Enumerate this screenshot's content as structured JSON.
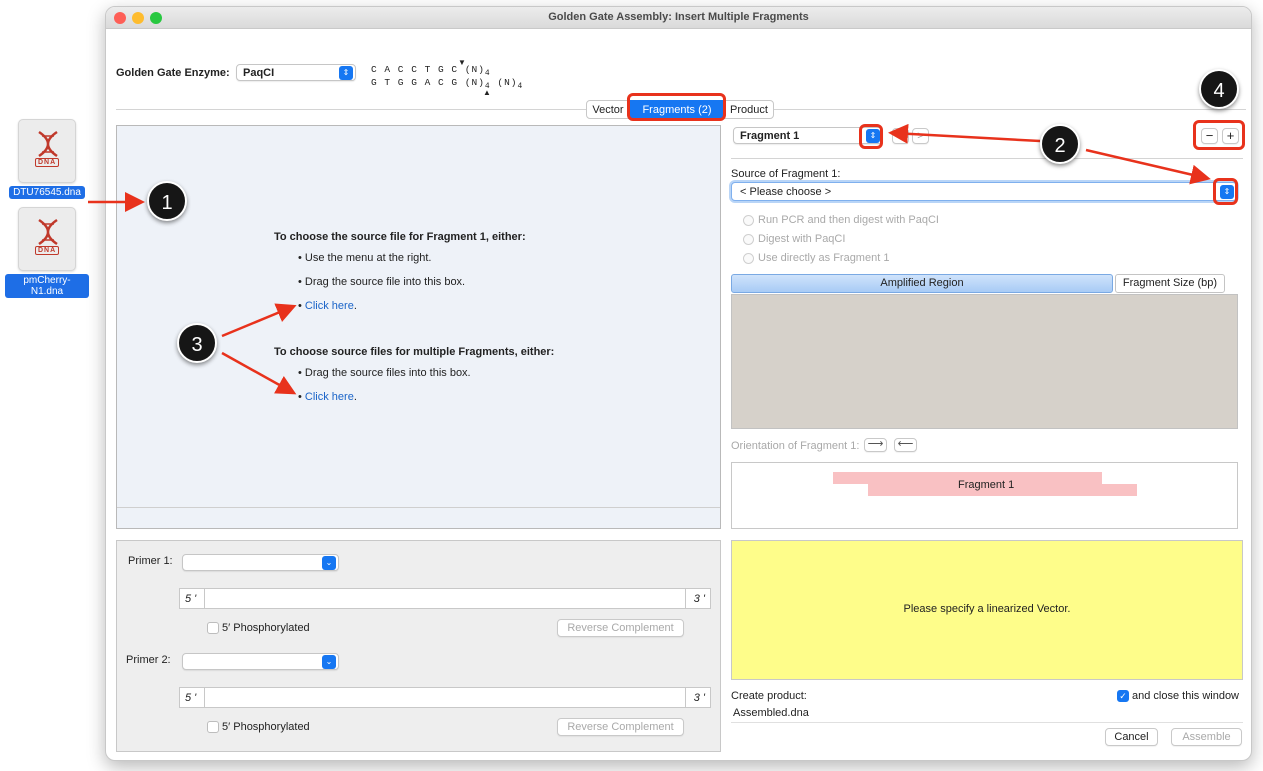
{
  "desktop": {
    "file1": "DTU76545.dna",
    "file2": "pmCherry-N1.dna",
    "dna_badge": "DNA"
  },
  "window": {
    "title": "Golden Gate Assembly: Insert Multiple Fragments"
  },
  "enzyme": {
    "label": "Golden Gate Enzyme:",
    "value": "PaqCI",
    "seq_top": "C A C C T G C (N)",
    "seq_bottom": "G T G G A C G (N)",
    "sub": "4",
    "tail": "(N)",
    "tail_sub": "4"
  },
  "tabs": [
    {
      "label": "Vector",
      "selected": false
    },
    {
      "label": "Fragments (2)",
      "selected": true
    },
    {
      "label": "Product",
      "selected": false
    }
  ],
  "drop": {
    "heading1": "To choose the source file for Fragment 1, either:",
    "item1": "Use the menu at the right.",
    "item2": "Drag the source file into this box.",
    "click1": "Click here",
    "heading2": "To choose source files for multiple Fragments, either:",
    "item3": "Drag the source files into this box.",
    "click2": "Click here",
    "dot": "."
  },
  "primer1": {
    "label": "Primer 1:",
    "five": "5 '",
    "three": "3 '",
    "phos": "5′ Phosphorylated",
    "revcomp": "Reverse Complement"
  },
  "primer2": {
    "label": "Primer 2:",
    "five": "5 '",
    "three": "3 '",
    "phos": "5′ Phosphorylated",
    "revcomp": "Reverse Complement"
  },
  "fragment": {
    "select": "Fragment 1",
    "source_label": "Source of Fragment 1:",
    "source_value": "< Please choose >",
    "opt1": "Run PCR and then digest with PaqCI",
    "opt2": "Digest with PaqCI",
    "opt3": "Use directly as Fragment 1",
    "tab_amplified": "Amplified Region",
    "tab_size": "Fragment Size (bp)",
    "orientation": "Orientation of Fragment 1:",
    "map_label": "Fragment 1"
  },
  "product": {
    "message": "Please specify a linearized Vector.",
    "create_label": "Create product:",
    "close_label": "and close this window",
    "filename": "Assembled.dna",
    "cancel": "Cancel",
    "assemble": "Assemble"
  },
  "callouts": [
    "1",
    "2",
    "3",
    "4"
  ],
  "colors": {
    "accent": "#1677f2",
    "callout_red": "#e8321c",
    "yellow": "#fefd8a",
    "fragment_pink": "#f9c1c3"
  }
}
